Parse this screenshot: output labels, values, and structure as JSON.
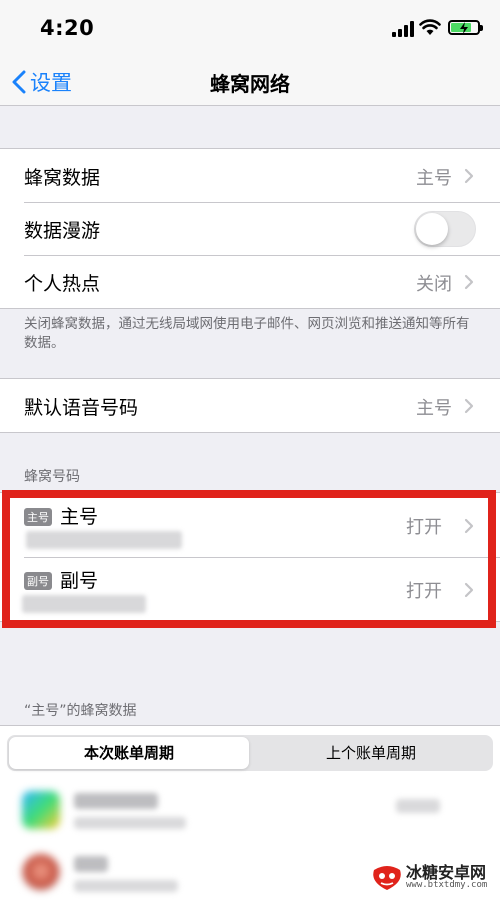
{
  "status_bar": {
    "time": "4:20"
  },
  "nav": {
    "back_label": "设置",
    "title": "蜂窝网络"
  },
  "group1": {
    "cellular_data": {
      "label": "蜂窝数据",
      "value": "主号"
    },
    "data_roaming": {
      "label": "数据漫游",
      "toggle_on": false
    },
    "personal_hotspot": {
      "label": "个人热点",
      "value": "关闭"
    }
  },
  "group1_footer": "关闭蜂窝数据，通过无线局域网使用电子邮件、网页浏览和推送通知等所有数据。",
  "group2": {
    "default_voice_line": {
      "label": "默认语音号码",
      "value": "主号"
    }
  },
  "cellular_plans": {
    "header": "蜂窝号码",
    "plans": [
      {
        "badge": "主号",
        "name": "主号",
        "value": "打开"
      },
      {
        "badge": "副号",
        "name": "副号",
        "value": "打开"
      }
    ]
  },
  "usage": {
    "header": "“主号”的蜂窝数据",
    "segments": {
      "current": "本次账单周期",
      "previous": "上个账单周期"
    }
  },
  "watermark": {
    "title": "冰糖安卓网",
    "url": "www.btxtdmy.com"
  },
  "colors": {
    "accent": "#1a82fb",
    "highlight_frame": "#e0231b",
    "switch_off": "#e9e9ea"
  }
}
